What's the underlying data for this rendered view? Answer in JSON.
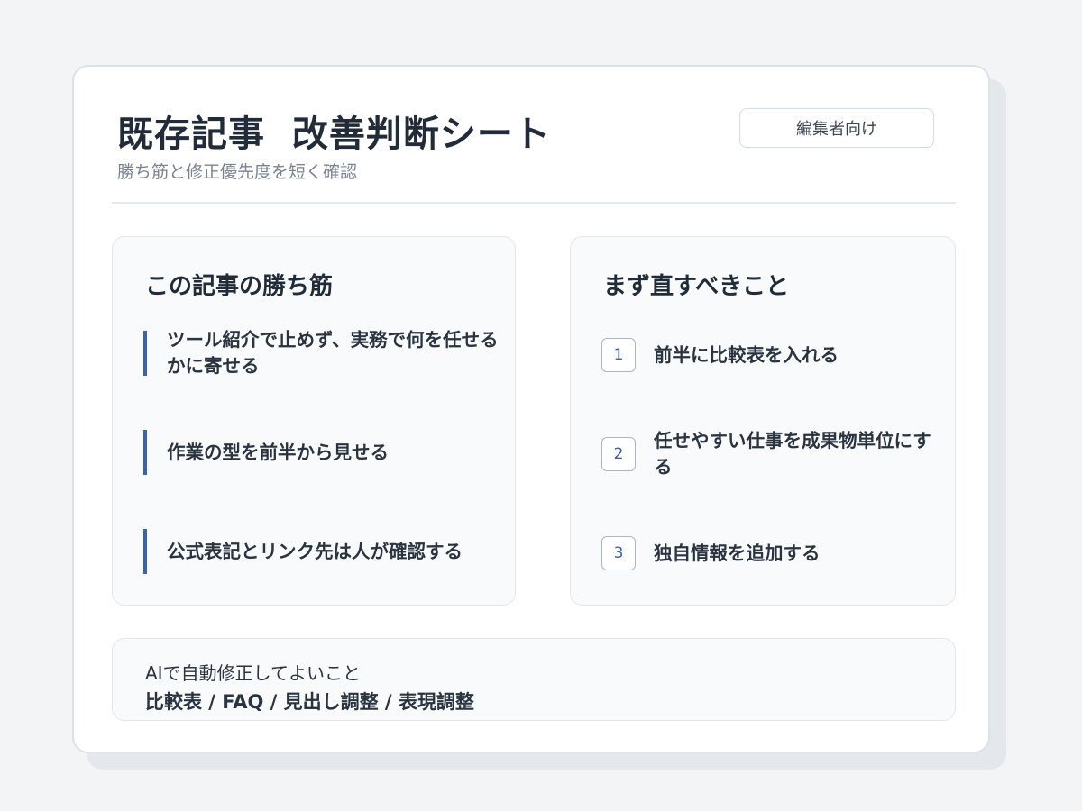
{
  "header": {
    "title": "既存記事  改善判断シート",
    "subtitle": "勝ち筋と修正優先度を短く確認",
    "badge": "編集者向け"
  },
  "winning_points": {
    "title": "この記事の勝ち筋",
    "items": [
      "ツール紹介で止めず、実務で何を任せるかに寄せる",
      "作業の型を前半から見せる",
      "公式表記とリンク先は人が確認する"
    ]
  },
  "fix_first": {
    "title": "まず直すべきこと",
    "items": [
      {
        "number": "1",
        "text": "前半に比較表を入れる"
      },
      {
        "number": "2",
        "text": "任せやすい仕事を成果物単位にする"
      },
      {
        "number": "3",
        "text": "独自情報を追加する"
      }
    ]
  },
  "ai_auto_fix": {
    "label": "AIで自動修正してよいこと",
    "items": "比較表 / FAQ / 見出し調整 / 表現調整"
  },
  "colors": {
    "accent": "#3a63a8",
    "background": "#f3f4f6",
    "card": "#ffffff",
    "panel": "#f9fafb",
    "text": "#222b38"
  }
}
